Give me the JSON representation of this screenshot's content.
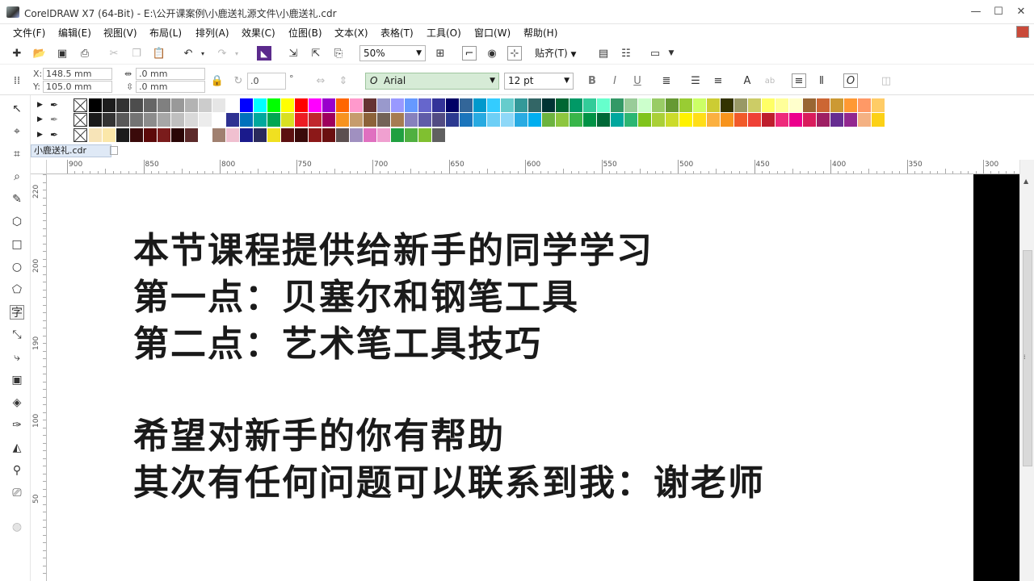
{
  "titlebar": {
    "title": "CorelDRAW X7 (64-Bit) - E:\\公开课案例\\小鹿送礼源文件\\小鹿送礼.cdr",
    "minimize": "—",
    "maximize": "☐",
    "close": "✕"
  },
  "menu": [
    "文件(F)",
    "编辑(E)",
    "视图(V)",
    "布局(L)",
    "排列(A)",
    "效果(C)",
    "位图(B)",
    "文本(X)",
    "表格(T)",
    "工具(O)",
    "窗口(W)",
    "帮助(H)"
  ],
  "toolbar": {
    "zoom": "50%",
    "snap_label": "贴齐(T)",
    "icons": [
      "new-icon",
      "open-icon",
      "save-icon",
      "print-icon",
      "cut-icon",
      "copy-icon",
      "paste-icon",
      "undo-icon",
      "redo-icon",
      "search-content-icon",
      "import-icon",
      "export-icon",
      "publish-pdf-icon",
      "zoom-level",
      "full-screen-icon",
      "rulers-icon",
      "grid-icon",
      "guidelines-icon",
      "welcome-icon",
      "options-icon",
      "app-launcher-icon"
    ]
  },
  "properties": {
    "x_label": "X:",
    "x_value": "148.5 mm",
    "y_label": "Y:",
    "y_value": "105.0 mm",
    "w_value": ".0 mm",
    "h_value": ".0 mm",
    "rotation": ".0",
    "degree_symbol": "°",
    "font_name": "Arial",
    "font_size": "12 pt"
  },
  "palettes": [
    {
      "colors": [
        "#000000",
        "#1c1c1c",
        "#333333",
        "#4d4d4d",
        "#666666",
        "#808080",
        "#999999",
        "#b3b3b3",
        "#cccccc",
        "#e6e6e6",
        "#ffffff",
        "#0000ff",
        "#00ffff",
        "#00ff00",
        "#ffff00",
        "#ff0000",
        "#ff00ff",
        "#9900cc",
        "#ff6600",
        "#ff99cc",
        "#663333",
        "#9999cc",
        "#9999ff",
        "#6699ff",
        "#6666cc",
        "#333399",
        "#000066",
        "#336699",
        "#0099cc",
        "#33ccff",
        "#66cccc",
        "#339999",
        "#336666",
        "#003333",
        "#006633",
        "#009966",
        "#33cc99",
        "#66ffcc",
        "#339966",
        "#99cc99",
        "#ccffcc",
        "#99cc66",
        "#669933",
        "#99cc33",
        "#ccff66",
        "#cccc33",
        "#333300",
        "#999966",
        "#cccc66",
        "#ffff66",
        "#ffff99",
        "#ffffcc",
        "#996633",
        "#cc6633",
        "#cc9933",
        "#ff9933",
        "#ff9966",
        "#ffcc66"
      ]
    },
    {
      "colors": [
        "#1a1a1a",
        "#333333",
        "#595959",
        "#737373",
        "#8c8c8c",
        "#a6a6a6",
        "#bfbfbf",
        "#d9d9d9",
        "#ececec",
        "#ffffff",
        "#2e3192",
        "#0071bc",
        "#00a99d",
        "#00a651",
        "#d9e021",
        "#ed1c24",
        "#c1272d",
        "#9e005d",
        "#f7931e",
        "#c69c6d",
        "#8c6239",
        "#736357",
        "#a67c52",
        "#8781bd",
        "#605ca8",
        "#524b83",
        "#2b3990",
        "#1b75bc",
        "#27aae1",
        "#6dcff6",
        "#8ed8f8",
        "#29abe2",
        "#00aeef",
        "#6cb33f",
        "#8dc63f",
        "#39b54a",
        "#009245",
        "#006837",
        "#00a79d",
        "#2bb673",
        "#80c41c",
        "#aad037",
        "#cbdb2a",
        "#fff200",
        "#ffde17",
        "#fbb040",
        "#f7941d",
        "#f15a29",
        "#ef4136",
        "#be1e2d",
        "#ee2a7b",
        "#ec008c",
        "#d91c5c",
        "#9e1f63",
        "#662d91",
        "#92278f",
        "#f4b183",
        "#fcd116"
      ]
    },
    {
      "colors": [
        "#f7e4b8",
        "#fbe7a9",
        "#1c1c1c",
        "#3a0a0a",
        "#5c0a0a",
        "#7a1c1c",
        "#2a0505",
        "#5c2a2a",
        "#ffffff",
        "#a08070",
        "#f0c0d0",
        "#1a1a8c",
        "#2a2a5c",
        "#f0e020",
        "#5c1010",
        "#3a0a0a",
        "#8c1818",
        "#6a1010",
        "#5c5050",
        "#a090c0",
        "#e070c0",
        "#f0a0d0",
        "#20a040",
        "#50b040",
        "#80c030",
        "#606060"
      ]
    }
  ],
  "document": {
    "tab_name": "小鹿送礼.cdr"
  },
  "ruler": {
    "h_labels": [
      "900",
      "850",
      "800",
      "750",
      "700",
      "650",
      "600",
      "550",
      "500",
      "450",
      "400",
      "350",
      "300"
    ],
    "v_labels": [
      "220",
      "200",
      "190",
      "100",
      "50"
    ]
  },
  "canvas": {
    "lines": [
      "本节课程提供给新手的同学学习",
      "第一点：贝塞尔和钢笔工具",
      "第二点：艺术笔工具技巧",
      "希望对新手的你有帮助",
      "其次有任何问题可以联系到我：谢老师"
    ]
  }
}
